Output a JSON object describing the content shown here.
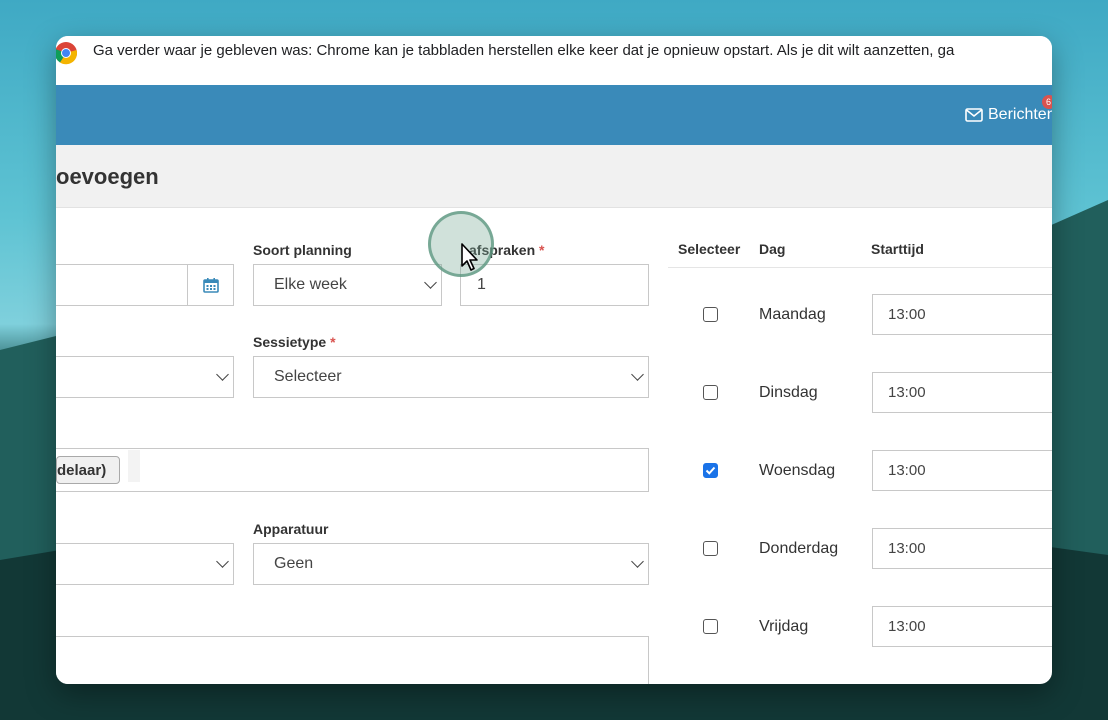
{
  "infobar": {
    "text": "Ga verder waar je gebleven was: Chrome kan je tabbladen herstellen elke keer dat je opnieuw opstart. Als je dit wilt aanzetten, ga"
  },
  "header": {
    "messages_label": "Berichten",
    "messages_badge": "6",
    "accent": "#3a8ab9"
  },
  "page": {
    "title": "oevoegen"
  },
  "form": {
    "date_value": "",
    "schedule_type": {
      "label": "Soort planning",
      "value": "Elke week"
    },
    "appointments": {
      "label": "afspraken",
      "required_mark": "*",
      "value": "1"
    },
    "session_type": {
      "label": "Sessietype",
      "required_mark": "*",
      "value": "Selecteer"
    },
    "tag_label": "delaar)",
    "equipment": {
      "label": "Apparatuur",
      "value": "Geen"
    }
  },
  "days_table": {
    "headers": {
      "select": "Selecteer",
      "day": "Dag",
      "start": "Starttijd"
    },
    "rows": [
      {
        "day": "Maandag",
        "checked": false,
        "time": "13:00"
      },
      {
        "day": "Dinsdag",
        "checked": false,
        "time": "13:00"
      },
      {
        "day": "Woensdag",
        "checked": true,
        "time": "13:00"
      },
      {
        "day": "Donderdag",
        "checked": false,
        "time": "13:00"
      },
      {
        "day": "Vrijdag",
        "checked": false,
        "time": "13:00"
      }
    ]
  }
}
